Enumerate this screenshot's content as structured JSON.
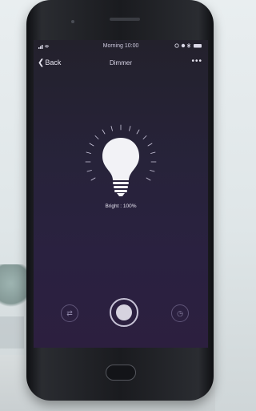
{
  "status_bar": {
    "signal": "▐▐▐",
    "wifi": "◠",
    "time": "Morning 10:00",
    "icons": "● ● ✱ ▬"
  },
  "nav": {
    "back_label": "Back",
    "title": "Dimmer",
    "more": "•••"
  },
  "bulb": {
    "bright_label": "Bright : 100%"
  },
  "controls": {
    "left_icon": "⇄",
    "right_icon": "◷"
  },
  "colors": {
    "screen_top": "#23212c",
    "screen_bottom": "#2c1f3f",
    "bulb": "#f2f2f6"
  }
}
